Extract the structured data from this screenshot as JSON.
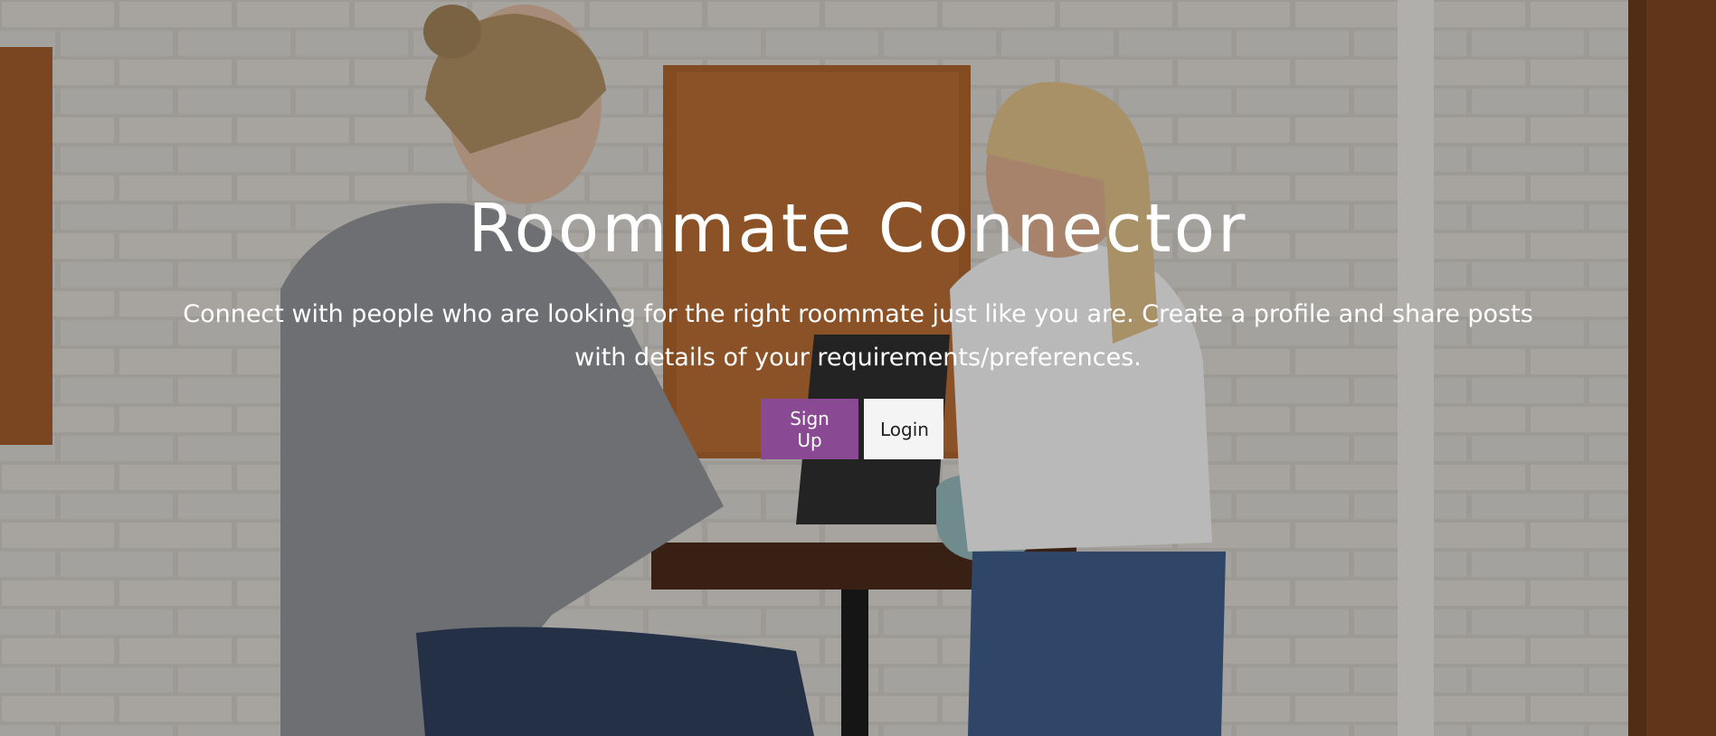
{
  "hero": {
    "title": "Roommate Connector",
    "subtitle": "Connect with people who are looking for the right roommate just like you are. Create a profile and share posts with details of your requirements/preferences.",
    "background_image": "background-photo-two-people-at-table"
  },
  "actions": {
    "signup_label": "Sign Up",
    "login_label": "Login"
  },
  "colors": {
    "accent": "#8a4a93",
    "secondary_button": "#f4f4f4",
    "text": "#ffffff"
  }
}
